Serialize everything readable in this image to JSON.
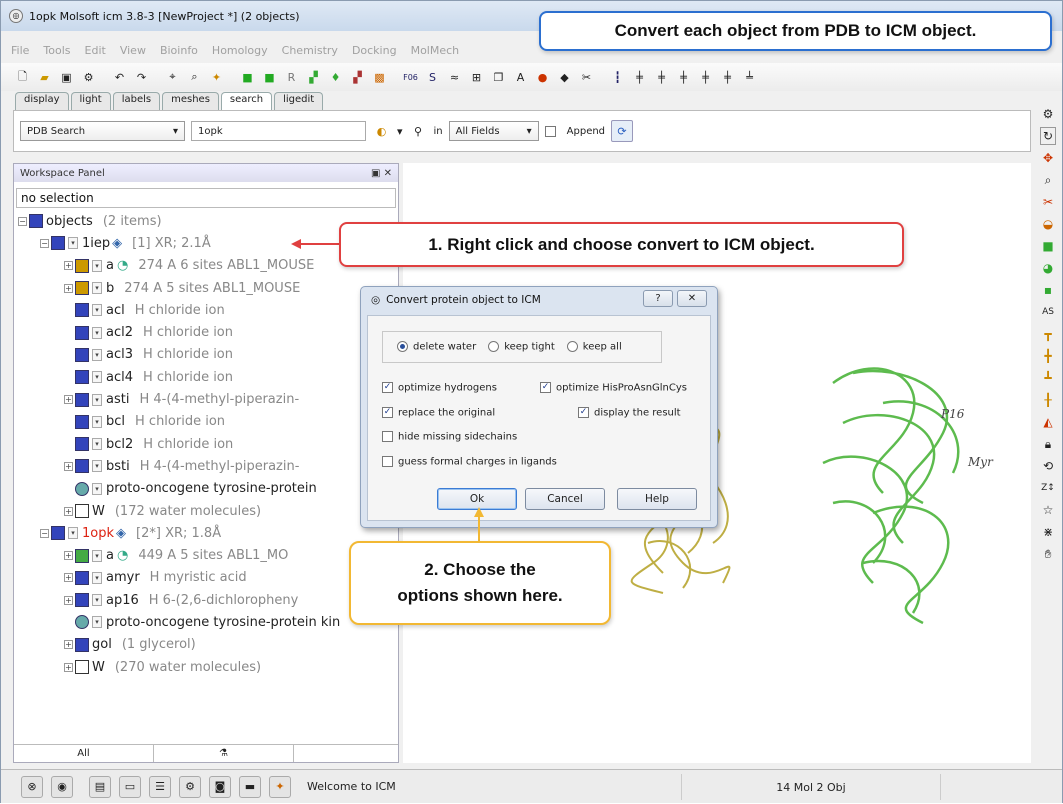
{
  "window": {
    "title": "1opk Molsoft icm 3.8-3  [NewProject *] (2 objects)"
  },
  "menu": [
    "File",
    "Tools",
    "Edit",
    "View",
    "Bioinfo",
    "Homology",
    "Chemistry",
    "Docking",
    "MolMech"
  ],
  "tabs": [
    "display",
    "light",
    "labels",
    "meshes",
    "search",
    "ligedit"
  ],
  "search": {
    "source": "PDB Search",
    "query": "1opk",
    "in_label": "in",
    "field": "All Fields",
    "append_label": "Append"
  },
  "panel": {
    "title": "Workspace Panel",
    "selection": "no selection",
    "tab_all": "All",
    "rows": [
      {
        "name": "objects",
        "info": "(2 items)"
      },
      {
        "name": "1iep",
        "info": "[1] XR; 2.1Å"
      },
      {
        "name": "a",
        "info": "274 A  6 sites ABL1_MOUSE"
      },
      {
        "name": "b",
        "info": "274 A  5 sites ABL1_MOUSE"
      },
      {
        "name": "acl",
        "info": "H   chloride ion"
      },
      {
        "name": "acl2",
        "info": "H   chloride ion"
      },
      {
        "name": "acl3",
        "info": "H   chloride ion"
      },
      {
        "name": "acl4",
        "info": "H   chloride ion"
      },
      {
        "name": "asti",
        "info": "H   4-(4-methyl-piperazin-"
      },
      {
        "name": "bcl",
        "info": "H   chloride ion"
      },
      {
        "name": "bcl2",
        "info": "H   chloride ion"
      },
      {
        "name": "bsti",
        "info": "H   4-(4-methyl-piperazin-"
      },
      {
        "name": "proto-oncogene tyrosine-protein",
        "info": ""
      },
      {
        "name": "W",
        "info": "(172 water molecules)"
      },
      {
        "name": "1opk",
        "info": "[2*] XR; 1.8Å"
      },
      {
        "name": "a",
        "info": "449 A  5 sites ABL1_MO"
      },
      {
        "name": "amyr",
        "info": "H   myristic acid"
      },
      {
        "name": "ap16",
        "info": "H   6-(2,6-dichloropheny"
      },
      {
        "name": "proto-oncogene tyrosine-protein kin",
        "info": ""
      },
      {
        "name": "gol",
        "info": "(1 glycerol)"
      },
      {
        "name": "W",
        "info": "(270 water molecules)"
      }
    ]
  },
  "viewer": {
    "label_p16": "P16",
    "label_myr": "Myr"
  },
  "dialog": {
    "title": "Convert protein object to ICM",
    "help_glyph": "?",
    "close_glyph": "✕",
    "radio_delete_water": "delete water",
    "radio_keep_tight": "keep tight",
    "radio_keep_all": "keep all",
    "opt_optimize_hydrogens": "optimize hydrogens",
    "opt_optimize_his": "optimize HisProAsnGlnCys",
    "opt_replace_original": "replace the original",
    "opt_display_result": "display the result",
    "opt_hide_missing": "hide missing sidechains",
    "opt_guess_charges": "guess formal charges in ligands",
    "ok_label": "Ok",
    "cancel_label": "Cancel",
    "help_label": "Help"
  },
  "status": {
    "message": "Welcome to ICM",
    "counts": "14 Mol 2 Obj"
  },
  "callouts": {
    "top": "Convert each object from PDB to ICM object.",
    "step1": "1. Right click and choose convert to ICM object.",
    "step2_line1": "2. Choose the",
    "step2_line2": "options shown here."
  }
}
